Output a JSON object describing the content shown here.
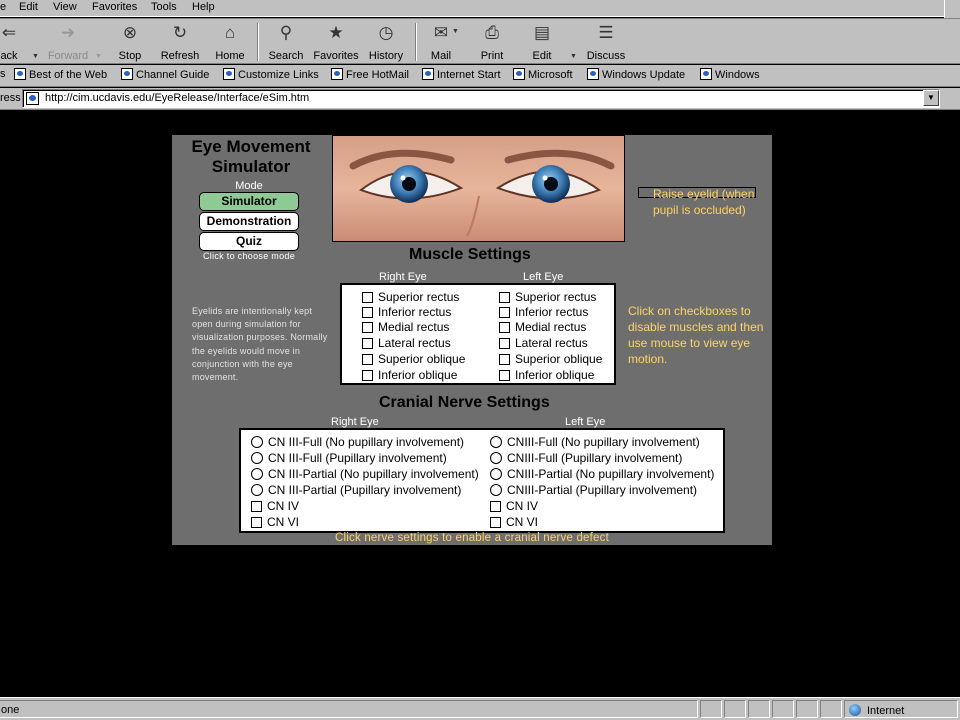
{
  "browser": {
    "menu": [
      "e",
      "Edit",
      "View",
      "Favorites",
      "Tools",
      "Help"
    ],
    "toolbar": {
      "back": "ack",
      "forward": "Forward",
      "stop": "Stop",
      "refresh": "Refresh",
      "home": "Home",
      "search": "Search",
      "favorites": "Favorites",
      "history": "History",
      "mail": "Mail",
      "print": "Print",
      "edit": "Edit",
      "discuss": "Discuss"
    },
    "links": [
      "s",
      "Best of the Web",
      "Channel Guide",
      "Customize Links",
      "Free HotMail",
      "Internet Start",
      "Microsoft",
      "Windows Update",
      "Windows"
    ],
    "address_label": "ress",
    "url": "http://cim.ucdavis.edu/EyeRelease/Interface/eSim.htm",
    "status_left": "one",
    "status_zone": "Internet"
  },
  "app": {
    "title_line1": "Eye Movement",
    "title_line2": "Simulator",
    "mode_label": "Mode",
    "modes": [
      "Simulator",
      "Demonstration",
      "Quiz"
    ],
    "active_mode": "Simulator",
    "mode_hint": "Click to choose mode",
    "eyelid_note": "Eyelids are intentionally kept open during simulation for visualization purposes. Normally the eyelids would move in conjunction with the eye movement.",
    "raise_eyelid": "Raise eyelid (when pupil is occluded)",
    "muscle": {
      "title": "Muscle Settings",
      "right_head": "Right Eye",
      "left_head": "Left  Eye",
      "items": [
        "Superior rectus",
        "Inferior rectus",
        "Medial rectus",
        "Lateral rectus",
        "Superior oblique",
        "Inferior oblique"
      ],
      "hint": "Click on checkboxes to disable muscles and then use mouse to view eye motion."
    },
    "nerve": {
      "title": "Cranial Nerve Settings",
      "right_head": "Right Eye",
      "left_head": "Left  Eye",
      "right_items": [
        "CN III-Full (No pupillary involvement)",
        "CN III-Full (Pupillary involvement)",
        "CN III-Partial (No pupillary involvement)",
        "CN III-Partial (Pupillary involvement)",
        "CN IV",
        "CN VI"
      ],
      "left_items": [
        "CNIII-Full (No pupillary involvement)",
        "CNIII-Full (Pupillary involvement)",
        "CNIII-Partial (No pupillary involvement)",
        "CNIII-Partial (Pupillary involvement)",
        "CN IV",
        "CN VI"
      ],
      "hint": "Click nerve settings to enable a cranial nerve defect"
    },
    "colors": {
      "panel": "#6e6e6e",
      "hint_text": "#ffd466",
      "active_mode": "#8fc994"
    }
  }
}
